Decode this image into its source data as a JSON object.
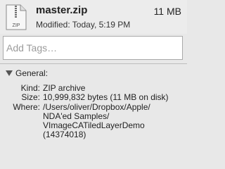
{
  "header": {
    "file_name": "master.zip",
    "file_size": "11 MB",
    "modified": "Modified: Today, 5:19 PM",
    "icon_label": "ZIP"
  },
  "tags": {
    "placeholder": "Add Tags…",
    "value": ""
  },
  "general": {
    "title": "General:",
    "rows": [
      {
        "label": "Kind:",
        "value": "ZIP archive"
      },
      {
        "label": "Size:",
        "value": "10,999,832 bytes (11 MB on disk)"
      },
      {
        "label": "Where:",
        "value": "/Users/oliver/Dropbox/Apple/\nNDA'ed Samples/\nVImageCATiledLayerDemo\n(14374018)"
      }
    ]
  }
}
